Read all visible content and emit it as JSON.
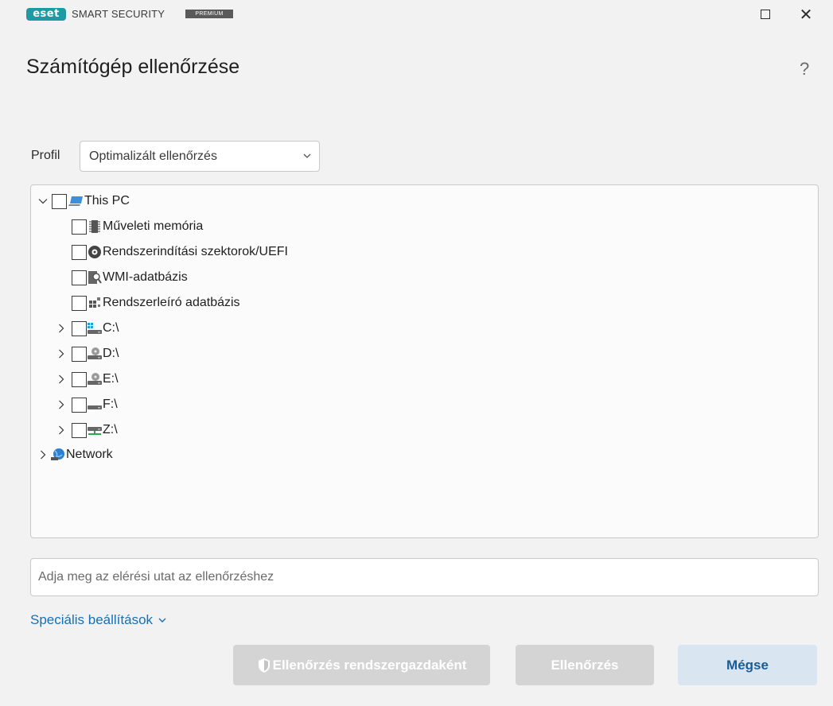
{
  "titlebar": {
    "logo_text": "eset",
    "product_name": "SMART SECURITY",
    "badge": "PREMIUM"
  },
  "header": {
    "title": "Számítógép ellenőrzése",
    "help": "?"
  },
  "profile": {
    "label": "Profil",
    "selected": "Optimalizált ellenőrzés"
  },
  "tree": {
    "root": {
      "label": "This PC",
      "expanded": true,
      "checked": false
    },
    "items": [
      {
        "label": "Műveleti memória",
        "icon": "memory-chip-icon",
        "checked": false
      },
      {
        "label": "Rendszerindítási szektorok/UEFI",
        "icon": "boot-disc-icon",
        "checked": false
      },
      {
        "label": "WMI-adatbázis",
        "icon": "wmi-database-icon",
        "checked": false
      },
      {
        "label": "Rendszerleíró adatbázis",
        "icon": "registry-icon",
        "checked": false
      },
      {
        "label": "C:\\",
        "icon": "system-drive-icon",
        "checked": false,
        "expandable": true
      },
      {
        "label": "D:\\",
        "icon": "optical-drive-icon",
        "checked": false,
        "expandable": true
      },
      {
        "label": "E:\\",
        "icon": "optical-drive-icon",
        "checked": false,
        "expandable": true
      },
      {
        "label": "F:\\",
        "icon": "removable-drive-icon",
        "checked": false,
        "expandable": true
      },
      {
        "label": "Z:\\",
        "icon": "network-drive-icon",
        "checked": false,
        "expandable": true
      }
    ],
    "network": {
      "label": "Network",
      "expandable": true
    }
  },
  "path_input": {
    "placeholder": "Adja meg az elérési utat az ellenőrzéshez",
    "value": ""
  },
  "advanced": {
    "label": "Speciális beállítások"
  },
  "buttons": {
    "admin_scan": "Ellenőrzés rendszergazdaként",
    "scan": "Ellenőrzés",
    "cancel": "Mégse"
  },
  "colors": {
    "accent_link": "#1670b5",
    "disabled_button": "#d4d4d4",
    "cancel_button": "#d9e6f1",
    "eset_teal": "#1d9aa5"
  }
}
